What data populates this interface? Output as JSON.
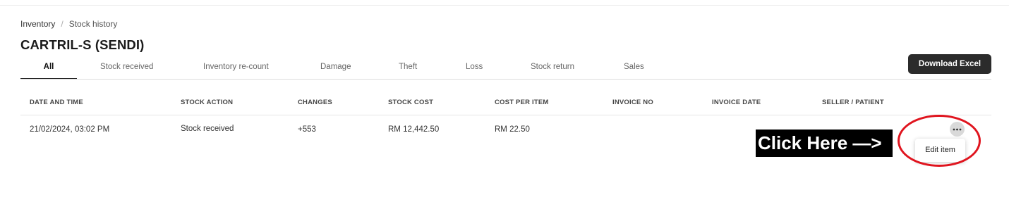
{
  "breadcrumb": {
    "root": "Inventory",
    "current": "Stock history"
  },
  "page_title": "CARTRIL-S (SENDI)",
  "tabs": [
    {
      "label": "All",
      "active": true
    },
    {
      "label": "Stock received"
    },
    {
      "label": "Inventory re-count"
    },
    {
      "label": "Damage"
    },
    {
      "label": "Theft"
    },
    {
      "label": "Loss"
    },
    {
      "label": "Stock return"
    },
    {
      "label": "Sales"
    }
  ],
  "download_label": "Download Excel",
  "table": {
    "columns": [
      "DATE AND TIME",
      "STOCK ACTION",
      "CHANGES",
      "STOCK COST",
      "COST PER ITEM",
      "INVOICE NO",
      "INVOICE DATE",
      "SELLER / PATIENT"
    ],
    "rows": [
      {
        "date_time": "21/02/2024, 03:02 PM",
        "stock_action": "Stock received",
        "changes": "+553",
        "stock_cost": "RM 12,442.50",
        "cost_per_item": "RM 22.50",
        "invoice_no": "",
        "invoice_date": "",
        "seller": ""
      }
    ]
  },
  "row_menu": {
    "items": [
      "Edit item"
    ]
  },
  "annotation": {
    "text": "Click Here —>",
    "color": "#e0141e"
  },
  "colors": {
    "primary_button": "#2b2b2b",
    "annotation_red": "#e0141e"
  }
}
